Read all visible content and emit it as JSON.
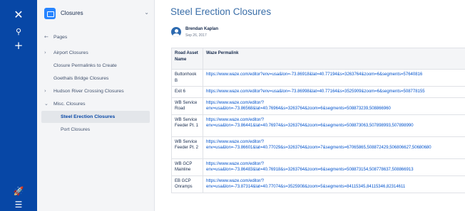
{
  "sidebar": {
    "space_name": "Closures",
    "items": [
      {
        "label": "Pages",
        "twisty": "←"
      },
      {
        "label": "Airport Closures",
        "twisty": "›"
      },
      {
        "label": "Closure Permalinks to Create",
        "twisty": ""
      },
      {
        "label": "Goethals Bridge Closures",
        "twisty": ""
      },
      {
        "label": "Hudson River Crossing Closures",
        "twisty": "›"
      },
      {
        "label": "Misc. Closures",
        "twisty": "⌄"
      },
      {
        "label": "Steel Erection Closures",
        "twisty": ""
      },
      {
        "label": "Port Closures",
        "twisty": ""
      }
    ]
  },
  "page": {
    "title": "Steel Erection Closures",
    "author": "Brendan Kaplan",
    "date": "Sep 26, 2017"
  },
  "table": {
    "headers": [
      "Road Asset Name",
      "Waze Permalink"
    ],
    "rows": [
      {
        "name": "Buttonhook B",
        "link": "https://www.waze.com/editor?env=usa&lon=-73.86918&lat=40.77194&s=3263764&zoom=6&segments=57640816"
      },
      {
        "name": "Exit 6",
        "link": "https://www.waze.com/editor?env=usa&lon=-73.86998&lat=40.77164&s=3525909&zoom=6&segments=508778155"
      },
      {
        "name": "WB Service Road",
        "link": "https://www.waze.com/editor/?\nenv=usa&lon=-73.86568&lat=40.76964&s=3263764&zoom=6&segments=508873239,508866960"
      },
      {
        "name": "WB Service Feeder Pt. 1",
        "link": "https://www.waze.com/editor/?\nenv=usa&lon=-73.86441&lat=40.76974&s=3263764&zoom=6&segments=508873063,507898993,507898990"
      },
      {
        "name": "WB Service Feeder Pt. 2",
        "link": "https://www.waze.com/editor/?\nenv=usa&lon=-73.86601&lat=40.77029&s=3263764&zoom=7&segments=67065865,508872429,506806627,50680680"
      },
      {
        "name": "WB GCP Mainline",
        "link": "https://www.waze.com/editor/?\nenv=usa&lon=-73.86483&lat=40.76918&s=3263764&zoom=6&segments=508873154,508778637,508866913"
      },
      {
        "name": "EB GCP Onramps",
        "link": "https://www.waze.com/editor/?\nenv=usa&lon=-73.87314&lat=40.77074&s=3525908&zoom=5&segments=84115345,84115346,82314611"
      }
    ]
  },
  "icons": {
    "rail": [
      "confluence-logo-icon",
      "search-icon",
      "create-icon",
      "rocket-icon",
      "menu-icon"
    ]
  },
  "colors": {
    "rail": "#0747a6",
    "link": "#0052cc",
    "title": "#3a6ea8"
  }
}
